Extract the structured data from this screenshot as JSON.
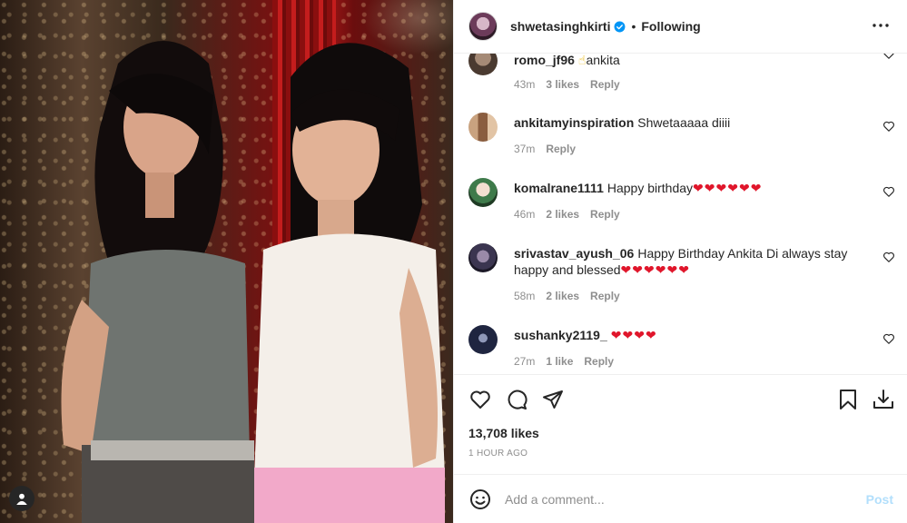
{
  "post": {
    "username": "shwetasinghkirti",
    "separator": "•",
    "follow_status": "Following"
  },
  "comments": [
    {
      "username": "romo_jf96",
      "text": "ankita",
      "emoji": "☝",
      "time": "43m",
      "likes": "3 likes",
      "reply": "Reply"
    },
    {
      "username": "ankitamyinspiration",
      "text": "Shwetaaaaa diiii",
      "time": "37m",
      "likes": "",
      "reply": "Reply"
    },
    {
      "username": "komalrane1111",
      "text": "Happy birthday",
      "hearts": "❤❤❤❤❤❤",
      "time": "46m",
      "likes": "2 likes",
      "reply": "Reply"
    },
    {
      "username": "srivastav_ayush_06",
      "text": "Happy Birthday Ankita Di always stay happy and blessed",
      "hearts": "❤❤❤❤❤❤",
      "time": "58m",
      "likes": "2 likes",
      "reply": "Reply"
    },
    {
      "username": "sushanky2119_",
      "text": "",
      "hearts": "❤❤❤❤",
      "time": "27m",
      "likes": "1 like",
      "reply": "Reply"
    }
  ],
  "stats": {
    "likes": "13,708 likes",
    "posted": "1 HOUR AGO"
  },
  "composer": {
    "placeholder": "Add a comment...",
    "post_label": "Post"
  },
  "icons": {
    "like": "heart-icon",
    "comment": "comment-icon",
    "share": "share-icon",
    "save": "bookmark-icon",
    "download": "download-icon",
    "emoji": "emoji-icon",
    "more": "more-options-icon"
  },
  "colors": {
    "heart_emoji": "#e0162b",
    "post_disabled": "#b2dffc",
    "verified": "#0095f6"
  }
}
